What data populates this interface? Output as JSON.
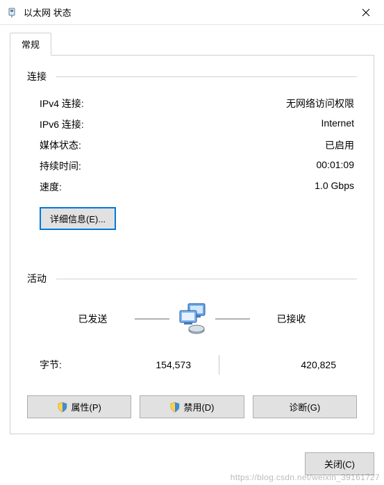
{
  "window": {
    "title": "以太网 状态"
  },
  "tabs": {
    "general": "常规"
  },
  "connection": {
    "heading": "连接",
    "ipv4_label": "IPv4 连接:",
    "ipv4_value": "无网络访问权限",
    "ipv6_label": "IPv6 连接:",
    "ipv6_value": "Internet",
    "media_label": "媒体状态:",
    "media_value": "已启用",
    "duration_label": "持续时间:",
    "duration_value": "00:01:09",
    "speed_label": "速度:",
    "speed_value": "1.0 Gbps",
    "details_button": "详细信息(E)..."
  },
  "activity": {
    "heading": "活动",
    "sent_label": "已发送",
    "received_label": "已接收",
    "bytes_label": "字节:",
    "bytes_sent": "154,573",
    "bytes_received": "420,825"
  },
  "buttons": {
    "properties": "属性(P)",
    "disable": "禁用(D)",
    "diagnose": "诊断(G)",
    "close": "关闭(C)"
  },
  "watermark": "https://blog.csdn.net/weixin_39161727"
}
